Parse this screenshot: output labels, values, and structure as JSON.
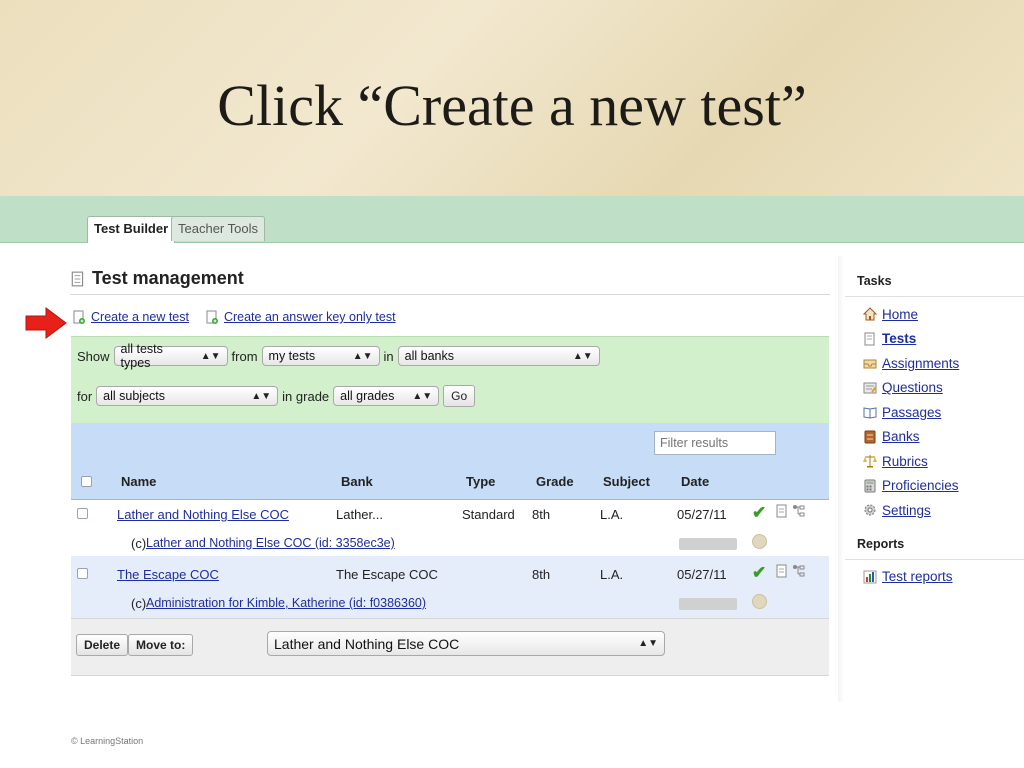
{
  "slide": {
    "title": "Click “Create a new test”"
  },
  "tabs": [
    {
      "label": "Test Builder",
      "active": true
    },
    {
      "label": "Teacher Tools",
      "active": false
    }
  ],
  "page": {
    "title": "Test management",
    "create_new_test": "Create a new test",
    "create_answer_key": "Create an answer key only test"
  },
  "filters": {
    "show_label": "Show",
    "types_value": "all tests types",
    "from_label": "from",
    "from_value": "my tests",
    "in_label": "in",
    "bank_value": "all banks",
    "for_label": "for",
    "subject_value": "all subjects",
    "grade_label": "in grade",
    "grade_value": "all grades",
    "go_label": "Go",
    "filter_placeholder": "Filter results"
  },
  "table": {
    "headers": {
      "name": "Name",
      "bank": "Bank",
      "type": "Type",
      "grade": "Grade",
      "subject": "Subject",
      "date": "Date"
    },
    "rows": [
      {
        "name": "Lather and Nothing Else COC",
        "bank": "Lather...",
        "type": "Standard",
        "grade": "8th",
        "subject": "L.A.",
        "date": "05/27/11",
        "sub_prefix": "(c)",
        "sub_link": "Lather and Nothing Else COC (id: 3358ec3e)"
      },
      {
        "name": "The Escape COC",
        "bank": "The Escape COC",
        "type": "",
        "grade": "8th",
        "subject": "L.A.",
        "date": "05/27/11",
        "sub_prefix": "(c)",
        "sub_link": "Administration for Kimble, Katherine (id: f0386360)"
      }
    ]
  },
  "actions": {
    "delete_label": "Delete",
    "move_label": "Move to:",
    "move_value": "Lather and Nothing Else COC"
  },
  "sidebar": {
    "tasks_heading": "Tasks",
    "tasks": [
      {
        "label": "Home",
        "icon": "home-icon"
      },
      {
        "label": "Tests",
        "icon": "document-icon",
        "current": true
      },
      {
        "label": "Assignments",
        "icon": "inbox-icon"
      },
      {
        "label": "Questions",
        "icon": "note-icon"
      },
      {
        "label": "Passages",
        "icon": "book-icon"
      },
      {
        "label": "Banks",
        "icon": "bank-icon"
      },
      {
        "label": "Rubrics",
        "icon": "scales-icon"
      },
      {
        "label": "Proficiencies",
        "icon": "calculator-icon"
      },
      {
        "label": "Settings",
        "icon": "gear-icon"
      }
    ],
    "reports_heading": "Reports",
    "reports": [
      {
        "label": "Test reports",
        "icon": "chart-icon"
      }
    ]
  },
  "footer": {
    "copyright": "© LearningStation"
  },
  "colors": {
    "accent_green": "#bfe0c6",
    "filter_green": "#d2f0cc",
    "table_blue": "#c7dcf7",
    "link_blue": "#1f2e9c",
    "arrow_red": "#e8201a"
  }
}
